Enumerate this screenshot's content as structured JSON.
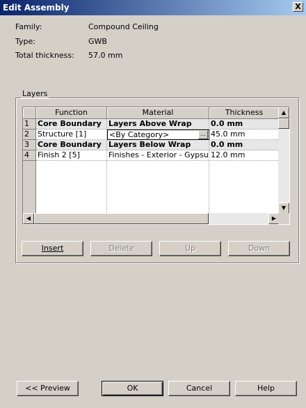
{
  "window": {
    "title": "Edit Assembly",
    "close_label": "X"
  },
  "info": {
    "family_label": "Family:",
    "family_value": "Compound Ceiling",
    "type_label": "Type:",
    "type_value": "GWB",
    "thickness_label": "Total thickness:",
    "thickness_value": "57.0 mm"
  },
  "layers": {
    "group_label": "Layers",
    "columns": {
      "function": "Function",
      "material": "Material",
      "thickness": "Thickness"
    },
    "rows": [
      {
        "num": "1",
        "function": "Core Boundary",
        "material": "Layers Above Wrap",
        "thickness": "0.0 mm"
      },
      {
        "num": "2",
        "function": "Structure [1]",
        "material": "<By Category>",
        "thickness": "45.0 mm"
      },
      {
        "num": "3",
        "function": "Core Boundary",
        "material": "Layers Below Wrap",
        "thickness": "0.0 mm"
      },
      {
        "num": "4",
        "function": "Finish 2 [5]",
        "material": "Finishes - Exterior - Gypsu",
        "thickness": "12.0 mm"
      }
    ],
    "material_browse_label": "..."
  },
  "buttons": {
    "insert": "Insert",
    "delete": "Delete",
    "up": "Up",
    "down": "Down",
    "preview": "<< Preview",
    "ok": "OK",
    "cancel": "Cancel",
    "help": "Help"
  },
  "icons": {
    "close": "close-icon",
    "scroll_up": "arrow-up-icon",
    "scroll_down": "arrow-down-icon",
    "scroll_left": "arrow-left-icon",
    "scroll_right": "arrow-right-icon"
  }
}
